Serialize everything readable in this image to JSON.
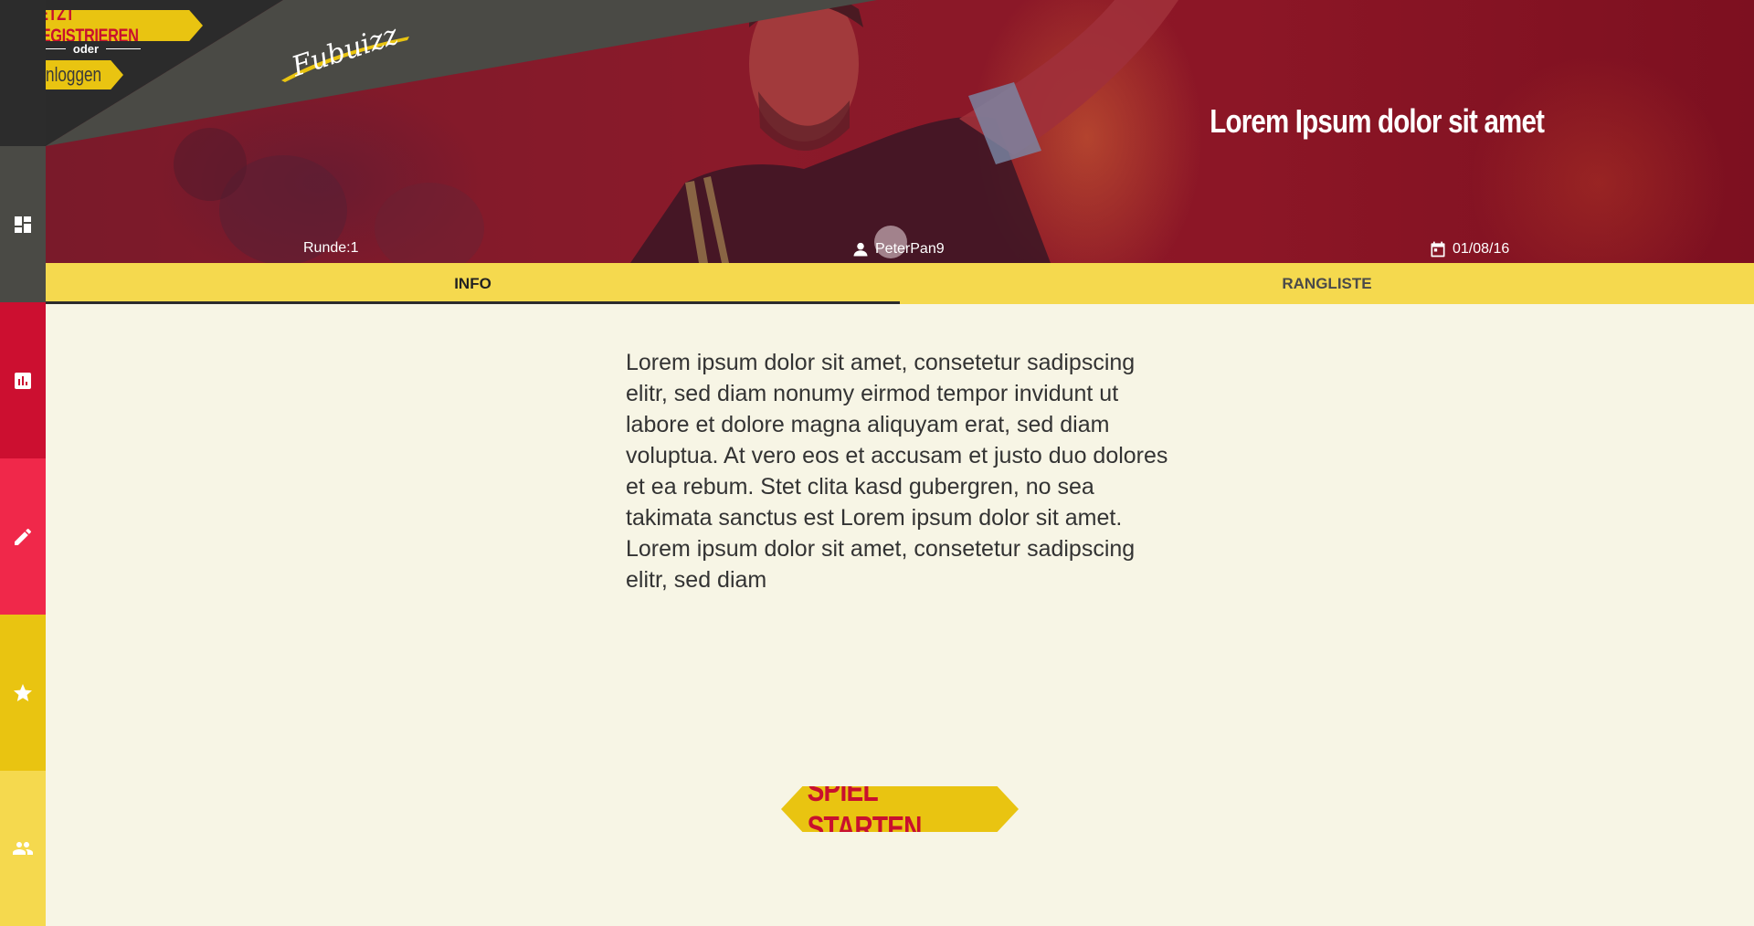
{
  "header": {
    "register_label": "JETZT REGISTRIEREN",
    "or_label": "oder",
    "login_label": "Einloggen",
    "logo_text": "Fubuizz",
    "title": "Lorem Ipsum dolor sit amet",
    "round": "Runde:1",
    "user": "PeterPan9",
    "date": "01/08/16"
  },
  "sidebar": {
    "items": [
      {
        "icon": "dashboard-icon",
        "color": "#4a4a45"
      },
      {
        "icon": "bar-chart-icon",
        "color": "#cc0f30"
      },
      {
        "icon": "pencil-icon",
        "color": "#f0284a"
      },
      {
        "icon": "star-icon",
        "color": "#e9c411"
      },
      {
        "icon": "people-icon",
        "color": "#f5d94e"
      }
    ]
  },
  "tabs": [
    {
      "label": "INFO",
      "active": true
    },
    {
      "label": "RANGLISTE",
      "active": false
    }
  ],
  "main": {
    "text": "Lorem ipsum dolor sit amet, consetetur sadipscing elitr, sed diam nonumy eirmod tempor invidunt ut labore et dolore magna aliquyam erat, sed diam voluptua. At vero eos et accusam et justo duo dolores et ea rebum. Stet clita kasd gubergren, no sea takimata sanctus est Lorem ipsum dolor sit amet. Lorem ipsum dolor sit amet, consetetur sadipscing elitr, sed diam",
    "start_label": "SPIEL STARTEN"
  },
  "colors": {
    "accent_yellow": "#e9c411",
    "accent_red": "#c8102e",
    "background": "#f7f5e5"
  }
}
